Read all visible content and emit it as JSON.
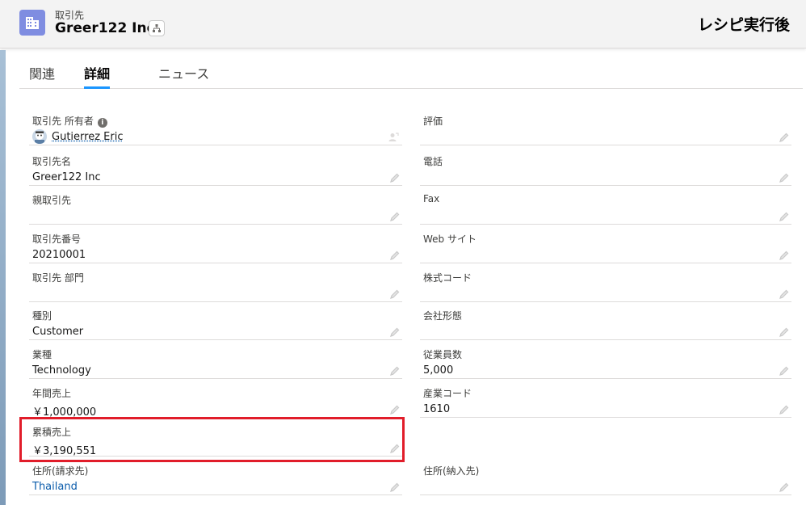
{
  "header": {
    "object_type": "取引先",
    "record_name": "Greer122 Inc",
    "overlay_label": "レシピ実行後"
  },
  "tabs": [
    "関連",
    "詳細",
    "ニュース"
  ],
  "active_tab": "詳細",
  "owner": {
    "label": "取引先 所有者",
    "info_glyph": "i",
    "name": "Gutierrez Eric"
  },
  "left_fields": [
    {
      "label": "取引先名",
      "value": "Greer122 Inc"
    },
    {
      "label": "親取引先",
      "value": ""
    },
    {
      "label": "取引先番号",
      "value": "20210001"
    },
    {
      "label": "取引先 部門",
      "value": ""
    },
    {
      "label": "種別",
      "value": "Customer"
    },
    {
      "label": "業種",
      "value": "Technology"
    },
    {
      "label": "年間売上",
      "value": "￥1,000,000"
    },
    {
      "label": "累積売上",
      "value": "￥3,190,551"
    },
    {
      "label": "住所(請求先)",
      "value": "Thailand"
    }
  ],
  "right_fields": [
    {
      "label": "評価",
      "value": ""
    },
    {
      "label": "電話",
      "value": ""
    },
    {
      "label": "Fax",
      "value": ""
    },
    {
      "label": "Web サイト",
      "value": ""
    },
    {
      "label": "株式コード",
      "value": ""
    },
    {
      "label": "会社形態",
      "value": ""
    },
    {
      "label": "従業員数",
      "value": "5,000"
    },
    {
      "label": "産業コード",
      "value": "1610"
    },
    {
      "label": "住所(納入先)",
      "value": ""
    }
  ],
  "colors": {
    "object_icon": "#7f8de1",
    "active_tab_underline": "#1b96ff",
    "link": "#0b5cab",
    "highlight_box": "#e11d2a"
  },
  "icons": {
    "object": "account-building-icon",
    "hierarchy": "hierarchy-icon",
    "edit": "pencil-icon",
    "change_owner": "change-owner-icon",
    "info": "info-icon",
    "avatar": "user-avatar-icon"
  }
}
